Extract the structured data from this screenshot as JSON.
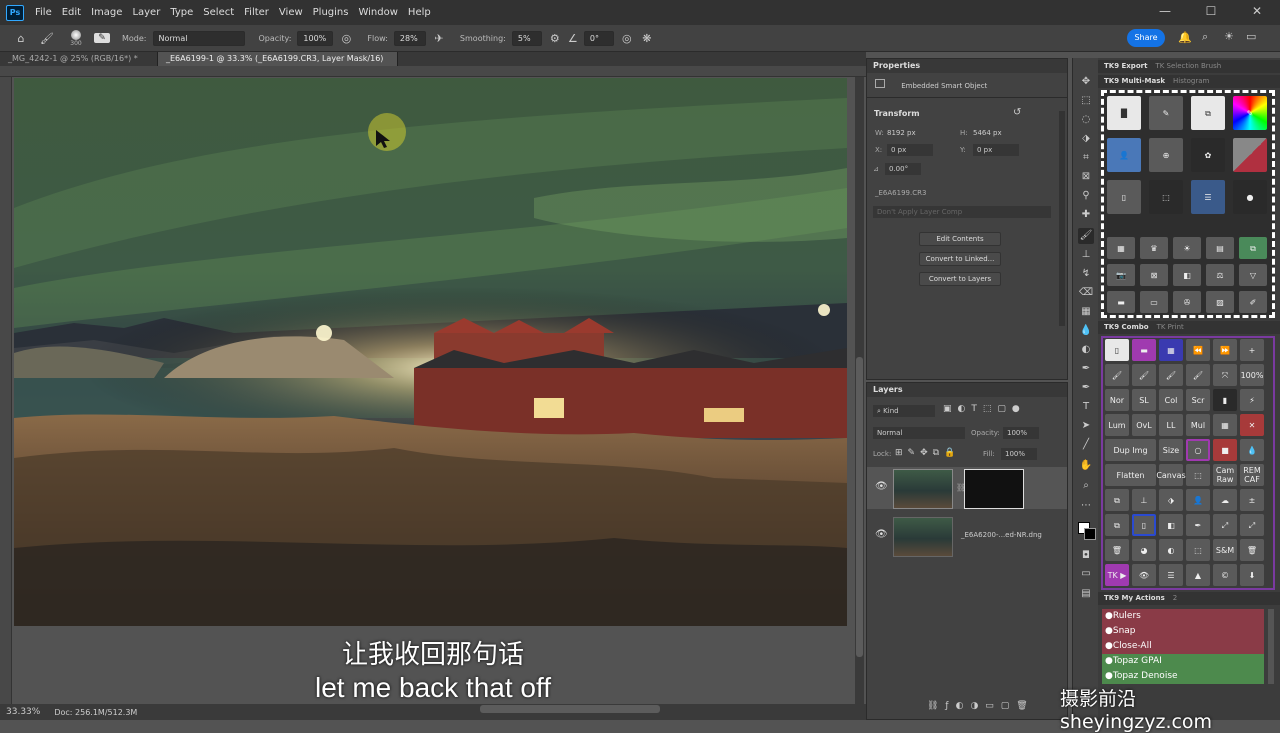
{
  "app": {
    "logo": "Ps",
    "menus": [
      "File",
      "Edit",
      "Image",
      "Layer",
      "Type",
      "Select",
      "Filter",
      "View",
      "Plugins",
      "Window",
      "Help"
    ],
    "window_buttons": [
      "—",
      "☐",
      "✕"
    ],
    "share_label": "Share"
  },
  "options": {
    "brush_size": "300",
    "mode_label": "Mode:",
    "mode_value": "Normal",
    "opacity_label": "Opacity:",
    "opacity_value": "100%",
    "flow_label": "Flow:",
    "flow_value": "28%",
    "smoothing_label": "Smoothing:",
    "smoothing_value": "5%",
    "angle_value": "0°"
  },
  "tabs": [
    {
      "label": "_MG_4242-1 @ 25% (RGB/16*) *",
      "close": "×"
    },
    {
      "label": "_E6A6199-1 @ 33.3% (_E6A6199.CR3, Layer Mask/16) *",
      "close": "×"
    }
  ],
  "status": {
    "zoom": "33.33%",
    "doc": "Doc: 256.1M/512.3M"
  },
  "subtitles": {
    "cn": "让我收回那句话",
    "en": "let me back that off"
  },
  "properties": {
    "title": "Properties",
    "object_type": "Embedded Smart Object",
    "transform_label": "Transform",
    "w_label": "W:",
    "w_value": "8192 px",
    "h_label": "H:",
    "h_value": "5464 px",
    "x_label": "X:",
    "x_value": "0 px",
    "y_label": "Y:",
    "y_value": "0 px",
    "angle_value": "0.00°",
    "file_name": "_E6A6199.CR3",
    "layer_comp_placeholder": "Don't Apply Layer Comp",
    "buttons": [
      "Edit Contents",
      "Convert to Linked...",
      "Convert to Layers"
    ]
  },
  "layers": {
    "title": "Layers",
    "filter_kind": "Kind",
    "blend_mode": "Normal",
    "opacity_label": "Opacity:",
    "opacity_value": "100%",
    "lock_label": "Lock:",
    "fill_label": "Fill:",
    "fill_value": "100%",
    "items": [
      {
        "name": ""
      },
      {
        "name": "_E6A6200-...ed-NR.dng"
      }
    ]
  },
  "tk9": {
    "export_tab": "TK9 Export",
    "selection_tab": "TK Selection Brush",
    "multimask_tab": "TK9 Multi-Mask",
    "histogram_tab": "Histogram",
    "combo_tab": "TK9 Combo",
    "print_tab": "TK Print",
    "combo_labels": [
      "100%",
      "Nor",
      "SL",
      "Col",
      "Scr",
      "Lum",
      "OvL",
      "LL",
      "Mul",
      "Dup Img",
      "Size",
      "Flatten",
      "Canvas",
      "Cam Raw",
      "REM CAF",
      "S&M",
      "TK ▶"
    ],
    "my_actions_tab": "TK9 My Actions",
    "my_actions_count": "2",
    "actions": [
      {
        "label": "●Rulers",
        "color": "#8a3b47"
      },
      {
        "label": "●Snap",
        "color": "#8a3b47"
      },
      {
        "label": "●Close-All",
        "color": "#8a3b47"
      },
      {
        "label": "●Topaz GPAI",
        "color": "#4d8a4d"
      },
      {
        "label": "●Topaz Denoise",
        "color": "#4d8a4d"
      }
    ]
  },
  "watermark": "摄影前沿sheyingzyz.com"
}
